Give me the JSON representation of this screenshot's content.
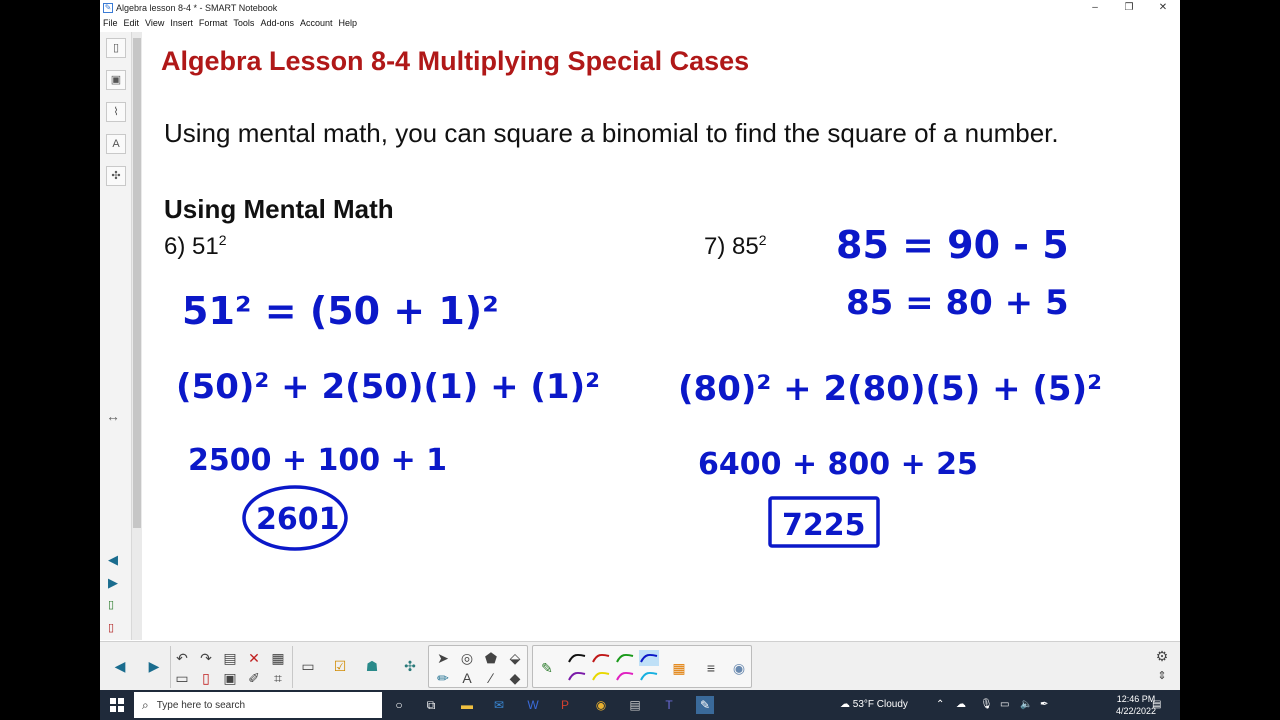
{
  "window": {
    "title": "Algebra lesson 8-4 * - SMART Notebook",
    "controls": [
      "–",
      "❐",
      "✕"
    ]
  },
  "menu": [
    "File",
    "Edit",
    "View",
    "Insert",
    "Format",
    "Tools",
    "Add-ons",
    "Account",
    "Help"
  ],
  "slide": {
    "title": "Algebra Lesson 8-4 Multiplying Special Cases",
    "intro": "Using mental math, you can square a binomial to find the square of a number.",
    "section": "Using Mental Math",
    "problem6": {
      "label": "6)  51",
      "exp": "2"
    },
    "problem7": {
      "label": "7)  85",
      "exp": "2"
    },
    "ink6": {
      "line1": "51² = (50 + 1)²",
      "line2": "(50)² + 2(50)(1) + (1)²",
      "line3": "2500 + 100 + 1",
      "answer": "2601"
    },
    "ink7": {
      "line1": "85 = 90 - 5",
      "line2": "85 = 80 + 5",
      "line3": "(80)² + 2(80)(5) + (5)²",
      "line4": "6400 + 800 + 25",
      "answer": "7225"
    },
    "ink_color": "#0b18c8",
    "title_color": "#b01818"
  },
  "taskbar": {
    "search_placeholder": "Type here to search",
    "weather": "53°F  Cloudy",
    "time": "12:46 PM",
    "date": "4/22/2022"
  }
}
